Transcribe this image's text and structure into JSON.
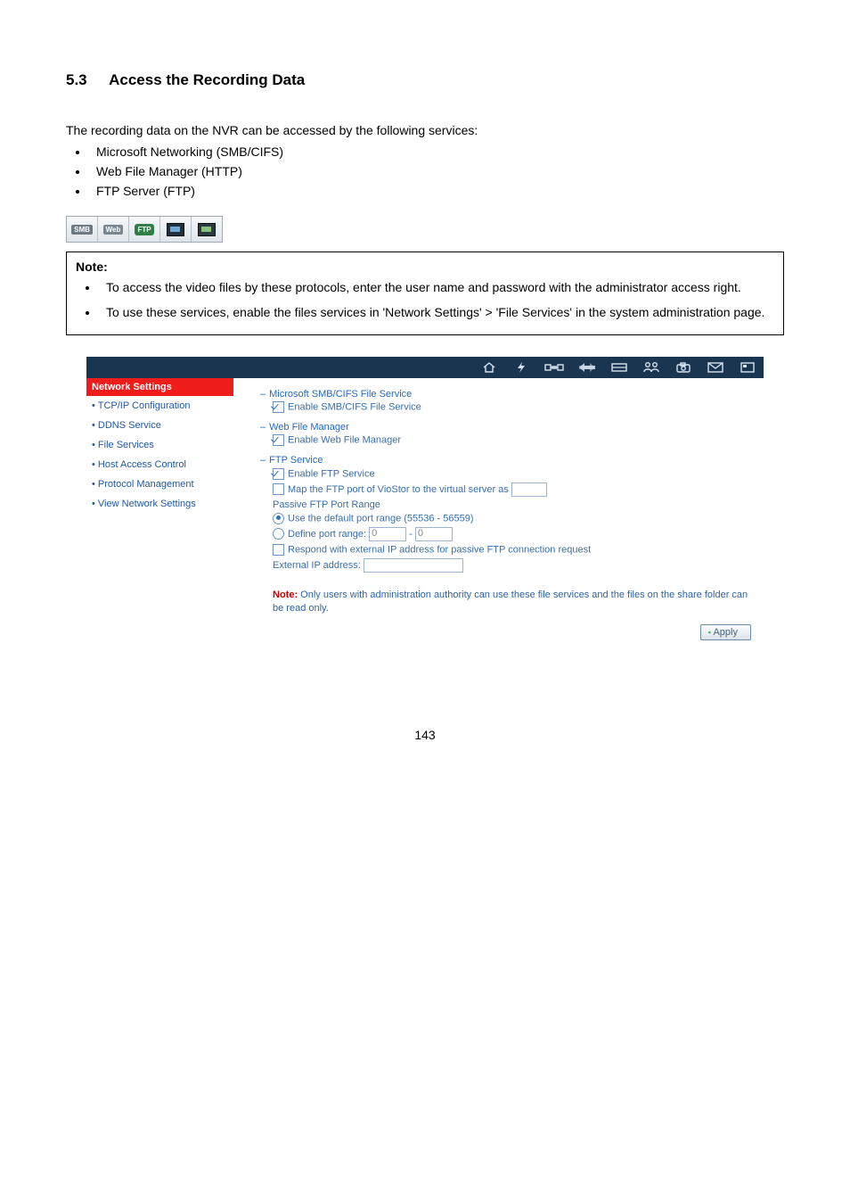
{
  "section": {
    "number": "5.3",
    "title": "Access the Recording Data"
  },
  "intro": "The recording data on the NVR can be accessed by the following services:",
  "services": [
    "Microsoft Networking (SMB/CIFS)",
    "Web File Manager (HTTP)",
    "FTP Server (FTP)"
  ],
  "iconbar": {
    "smb": "SMB",
    "web": "Web",
    "ftp": "FTP"
  },
  "note": {
    "label": "Note:",
    "items": [
      "To access the video files by these protocols, enter the user name and password with the administrator access right.",
      "To use these services, enable the files services in 'Network Settings' > 'File Services' in the system administration page."
    ]
  },
  "admin": {
    "sidebar": {
      "header": "Network Settings",
      "items": [
        "TCP/IP Configuration",
        "DDNS Service",
        "File Services",
        "Host Access Control",
        "Protocol Management",
        "View Network Settings"
      ]
    },
    "main": {
      "smb": {
        "title": "Microsoft SMB/CIFS File Service",
        "enable": "Enable SMB/CIFS File Service"
      },
      "wfm": {
        "title": "Web File Manager",
        "enable": "Enable Web File Manager"
      },
      "ftp": {
        "title": "FTP Service",
        "enable": "Enable FTP Service",
        "map": "Map the FTP port of VioStor to the virtual server as",
        "passive_title": "Passive FTP Port Range",
        "use_default": "Use the default port range (55536 - 56559)",
        "define_range": "Define port range:",
        "range_from": "0",
        "range_to": "0",
        "respond": "Respond with external IP address for passive FTP connection request",
        "ext_ip": "External IP address:"
      },
      "footnote": {
        "label": "Note:",
        "text": " Only users with administration authority can use these file services and the files on the share folder can be read only."
      },
      "apply": "Apply"
    }
  },
  "page_number": "143"
}
